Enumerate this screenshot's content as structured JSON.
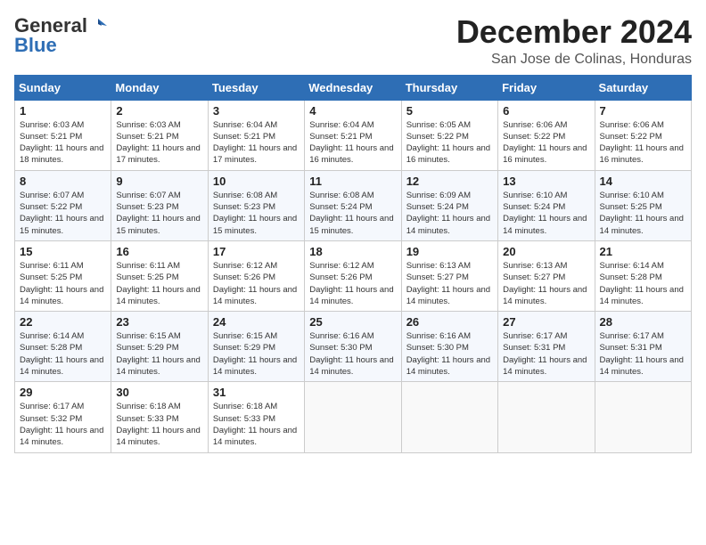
{
  "header": {
    "logo_general": "General",
    "logo_blue": "Blue",
    "main_title": "December 2024",
    "subtitle": "San Jose de Colinas, Honduras"
  },
  "calendar": {
    "days_of_week": [
      "Sunday",
      "Monday",
      "Tuesday",
      "Wednesday",
      "Thursday",
      "Friday",
      "Saturday"
    ],
    "weeks": [
      [
        {
          "day": "",
          "info": ""
        },
        {
          "day": "2",
          "info": "Sunrise: 6:03 AM\nSunset: 5:21 PM\nDaylight: 11 hours and 17 minutes."
        },
        {
          "day": "3",
          "info": "Sunrise: 6:04 AM\nSunset: 5:21 PM\nDaylight: 11 hours and 17 minutes."
        },
        {
          "day": "4",
          "info": "Sunrise: 6:04 AM\nSunset: 5:21 PM\nDaylight: 11 hours and 16 minutes."
        },
        {
          "day": "5",
          "info": "Sunrise: 6:05 AM\nSunset: 5:22 PM\nDaylight: 11 hours and 16 minutes."
        },
        {
          "day": "6",
          "info": "Sunrise: 6:06 AM\nSunset: 5:22 PM\nDaylight: 11 hours and 16 minutes."
        },
        {
          "day": "7",
          "info": "Sunrise: 6:06 AM\nSunset: 5:22 PM\nDaylight: 11 hours and 16 minutes."
        }
      ],
      [
        {
          "day": "8",
          "info": "Sunrise: 6:07 AM\nSunset: 5:22 PM\nDaylight: 11 hours and 15 minutes."
        },
        {
          "day": "9",
          "info": "Sunrise: 6:07 AM\nSunset: 5:23 PM\nDaylight: 11 hours and 15 minutes."
        },
        {
          "day": "10",
          "info": "Sunrise: 6:08 AM\nSunset: 5:23 PM\nDaylight: 11 hours and 15 minutes."
        },
        {
          "day": "11",
          "info": "Sunrise: 6:08 AM\nSunset: 5:24 PM\nDaylight: 11 hours and 15 minutes."
        },
        {
          "day": "12",
          "info": "Sunrise: 6:09 AM\nSunset: 5:24 PM\nDaylight: 11 hours and 14 minutes."
        },
        {
          "day": "13",
          "info": "Sunrise: 6:10 AM\nSunset: 5:24 PM\nDaylight: 11 hours and 14 minutes."
        },
        {
          "day": "14",
          "info": "Sunrise: 6:10 AM\nSunset: 5:25 PM\nDaylight: 11 hours and 14 minutes."
        }
      ],
      [
        {
          "day": "15",
          "info": "Sunrise: 6:11 AM\nSunset: 5:25 PM\nDaylight: 11 hours and 14 minutes."
        },
        {
          "day": "16",
          "info": "Sunrise: 6:11 AM\nSunset: 5:25 PM\nDaylight: 11 hours and 14 minutes."
        },
        {
          "day": "17",
          "info": "Sunrise: 6:12 AM\nSunset: 5:26 PM\nDaylight: 11 hours and 14 minutes."
        },
        {
          "day": "18",
          "info": "Sunrise: 6:12 AM\nSunset: 5:26 PM\nDaylight: 11 hours and 14 minutes."
        },
        {
          "day": "19",
          "info": "Sunrise: 6:13 AM\nSunset: 5:27 PM\nDaylight: 11 hours and 14 minutes."
        },
        {
          "day": "20",
          "info": "Sunrise: 6:13 AM\nSunset: 5:27 PM\nDaylight: 11 hours and 14 minutes."
        },
        {
          "day": "21",
          "info": "Sunrise: 6:14 AM\nSunset: 5:28 PM\nDaylight: 11 hours and 14 minutes."
        }
      ],
      [
        {
          "day": "22",
          "info": "Sunrise: 6:14 AM\nSunset: 5:28 PM\nDaylight: 11 hours and 14 minutes."
        },
        {
          "day": "23",
          "info": "Sunrise: 6:15 AM\nSunset: 5:29 PM\nDaylight: 11 hours and 14 minutes."
        },
        {
          "day": "24",
          "info": "Sunrise: 6:15 AM\nSunset: 5:29 PM\nDaylight: 11 hours and 14 minutes."
        },
        {
          "day": "25",
          "info": "Sunrise: 6:16 AM\nSunset: 5:30 PM\nDaylight: 11 hours and 14 minutes."
        },
        {
          "day": "26",
          "info": "Sunrise: 6:16 AM\nSunset: 5:30 PM\nDaylight: 11 hours and 14 minutes."
        },
        {
          "day": "27",
          "info": "Sunrise: 6:17 AM\nSunset: 5:31 PM\nDaylight: 11 hours and 14 minutes."
        },
        {
          "day": "28",
          "info": "Sunrise: 6:17 AM\nSunset: 5:31 PM\nDaylight: 11 hours and 14 minutes."
        }
      ],
      [
        {
          "day": "29",
          "info": "Sunrise: 6:17 AM\nSunset: 5:32 PM\nDaylight: 11 hours and 14 minutes."
        },
        {
          "day": "30",
          "info": "Sunrise: 6:18 AM\nSunset: 5:33 PM\nDaylight: 11 hours and 14 minutes."
        },
        {
          "day": "31",
          "info": "Sunrise: 6:18 AM\nSunset: 5:33 PM\nDaylight: 11 hours and 14 minutes."
        },
        {
          "day": "",
          "info": ""
        },
        {
          "day": "",
          "info": ""
        },
        {
          "day": "",
          "info": ""
        },
        {
          "day": "",
          "info": ""
        }
      ]
    ],
    "week1_day1": {
      "day": "1",
      "info": "Sunrise: 6:03 AM\nSunset: 5:21 PM\nDaylight: 11 hours and 18 minutes."
    }
  }
}
